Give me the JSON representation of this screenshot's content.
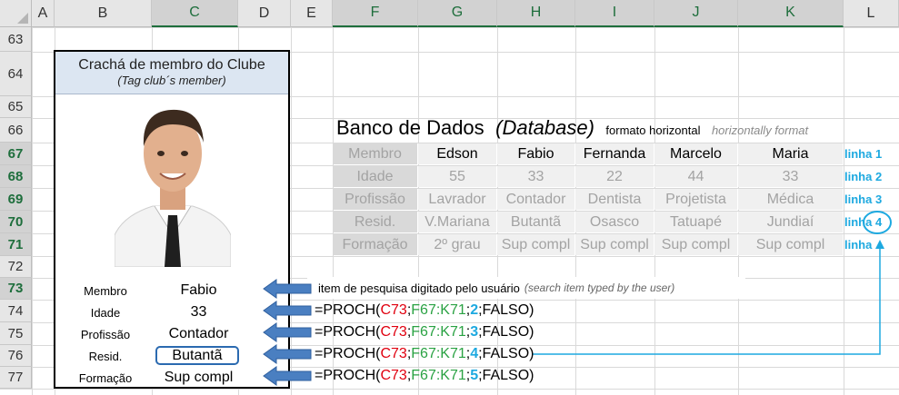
{
  "column_headers": [
    "A",
    "B",
    "C",
    "D",
    "E",
    "F",
    "G",
    "H",
    "I",
    "J",
    "K",
    "L"
  ],
  "row_headers": [
    "63",
    "64",
    "65",
    "66",
    "67",
    "68",
    "69",
    "70",
    "71",
    "72",
    "73",
    "74",
    "75",
    "76",
    "77"
  ],
  "badge": {
    "title": "Crachá de membro do Clube",
    "subtitle": "(Tag club´s member)",
    "labels": [
      "Membro",
      "Idade",
      "Profissão",
      "Resid.",
      "Formação"
    ],
    "values": [
      "Fabio",
      "33",
      "Contador",
      "Butantã",
      "Sup compl"
    ]
  },
  "database": {
    "title": "Banco de Dados",
    "title_italic": "(Database)",
    "note": "formato horizontal",
    "note_italic": "horizontally format",
    "rows": [
      {
        "label": "Membro",
        "values": [
          "Edson",
          "Fabio",
          "Fernanda",
          "Marcelo",
          "Maria"
        ],
        "tag": "linha 1"
      },
      {
        "label": "Idade",
        "values": [
          "55",
          "33",
          "22",
          "44",
          "33"
        ],
        "tag": "linha 2"
      },
      {
        "label": "Profissão",
        "values": [
          "Lavrador",
          "Contador",
          "Dentista",
          "Projetista",
          "Médica"
        ],
        "tag": "linha 3"
      },
      {
        "label": "Resid.",
        "values": [
          "V.Mariana",
          "Butantã",
          "Osasco",
          "Tatuapé",
          "Jundiaí"
        ],
        "tag": "linha 4"
      },
      {
        "label": "Formação",
        "values": [
          "2º grau",
          "Sup compl",
          "Sup compl",
          "Sup compl",
          "Sup compl"
        ],
        "tag": "linha"
      }
    ]
  },
  "search_note": "item de pesquisa digitado pelo usuário",
  "search_note_italic": "(search item typed by the user)",
  "formulas": [
    {
      "a": "=PROCH(",
      "b": "C73",
      "c": ";",
      "d": "F67:K71",
      "e": ";",
      "f": "2",
      "g": ";FALSO)"
    },
    {
      "a": "=PROCH(",
      "b": "C73",
      "c": ";",
      "d": "F67:K71",
      "e": ";",
      "f": "3",
      "g": ";FALSO)"
    },
    {
      "a": "=PROCH(",
      "b": "C73",
      "c": ";",
      "d": "F67:K71",
      "e": ";",
      "f": "4",
      "g": ";FALSO)"
    },
    {
      "a": "=PROCH(",
      "b": "C73",
      "c": ";",
      "d": "F67:K71",
      "e": ";",
      "f": "5",
      "g": ";FALSO)"
    }
  ],
  "colors": {
    "accent_green": "#1e6e3c",
    "arrow_blue": "#4a7fc1",
    "link_cyan": "#1da9e0",
    "ref_red": "#e0000f",
    "range_green": "#2aa243"
  }
}
